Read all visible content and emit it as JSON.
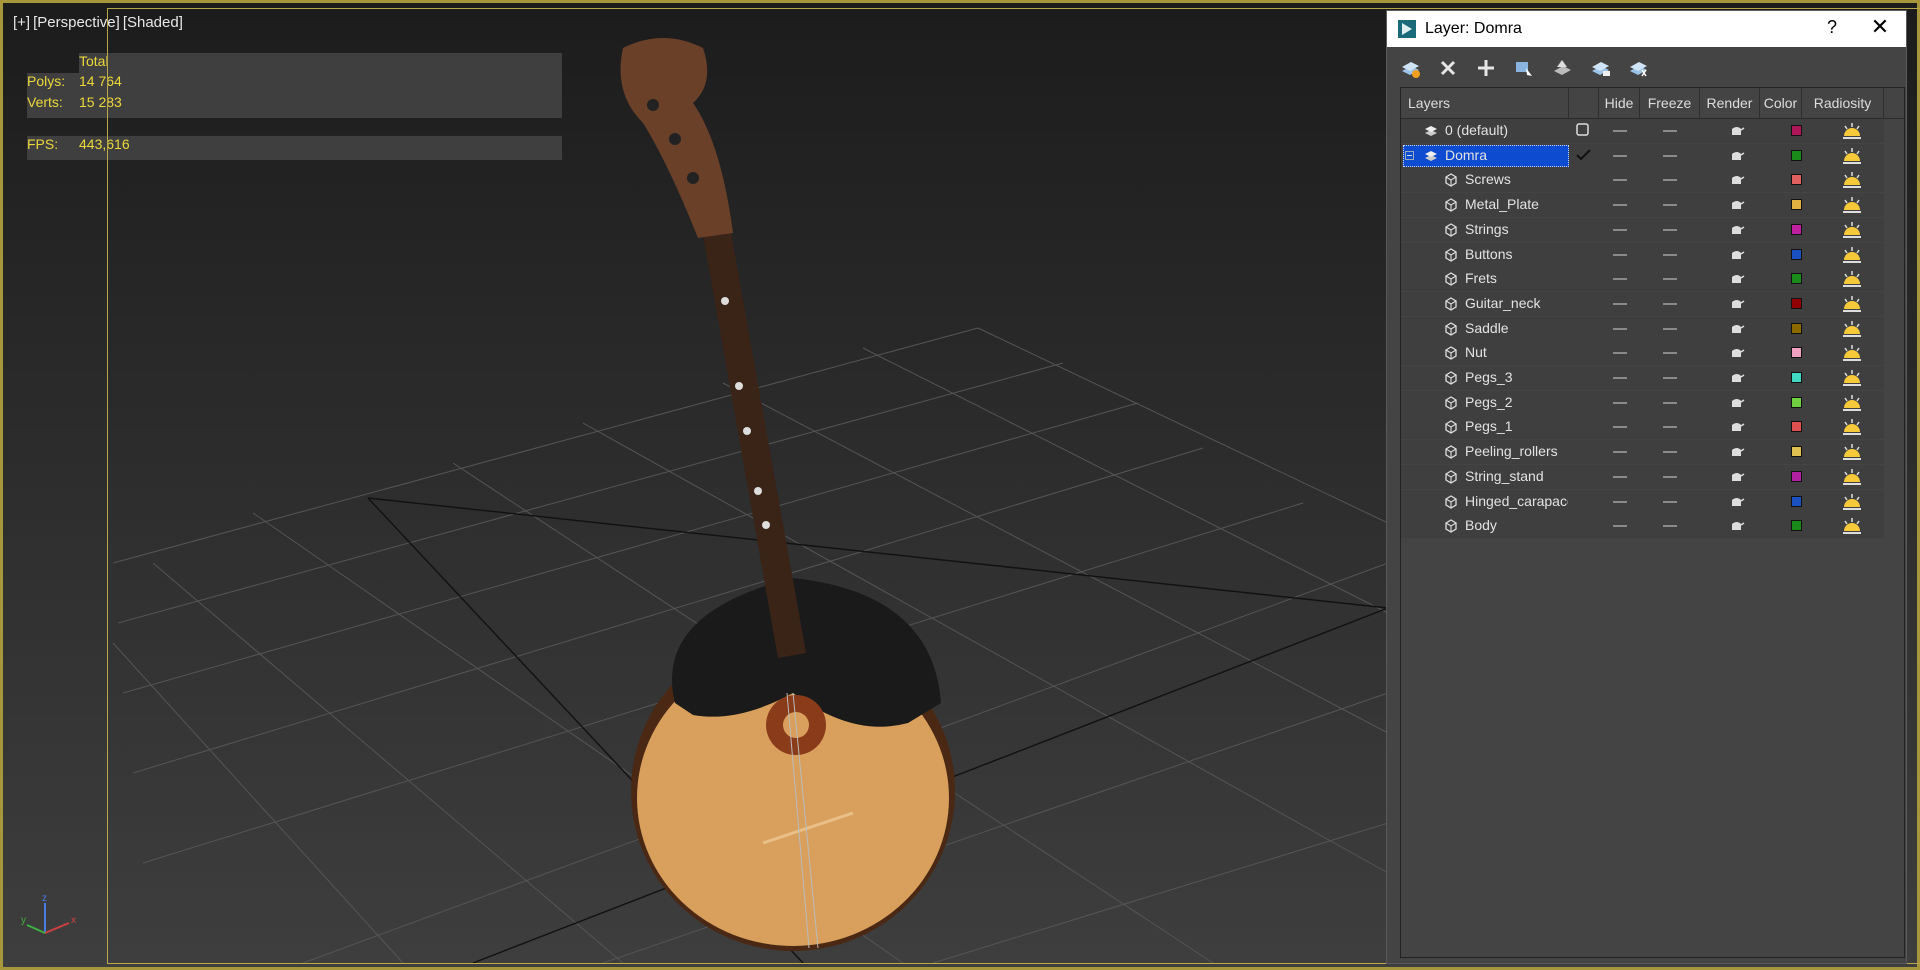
{
  "viewport": {
    "label": [
      "[+]",
      "[Perspective]",
      "[Shaded]"
    ],
    "stats": {
      "total_label": "Total",
      "polys_label": "Polys:",
      "polys_value": "14 764",
      "verts_label": "Verts:",
      "verts_value": "15 283",
      "fps_label": "FPS:",
      "fps_value": "443,616"
    },
    "gizmo": {
      "x": "x",
      "y": "y",
      "z": "z"
    }
  },
  "panel": {
    "title": "Layer: Domra",
    "help": "?",
    "close": "✕",
    "toolbar": [
      "new-layer-icon",
      "delete-layer-icon",
      "add-selection-icon",
      "select-objects-icon",
      "highlight-layer-icon",
      "hide-all-icon",
      "freeze-all-icon"
    ],
    "columns": {
      "layers": "Layers",
      "hide": "Hide",
      "freeze": "Freeze",
      "render": "Render",
      "color": "Color",
      "radiosity": "Radiosity"
    },
    "rows": [
      {
        "name": "0 (default)",
        "kind": "layer",
        "color": "#b0175a"
      },
      {
        "name": "Domra",
        "kind": "layer",
        "color": "#1a8a1a",
        "selected": true,
        "current": true
      },
      {
        "name": "Screws",
        "kind": "object",
        "color": "#e06060"
      },
      {
        "name": "Metal_Plate",
        "kind": "object",
        "color": "#e0b040"
      },
      {
        "name": "Strings",
        "kind": "object",
        "color": "#c020a0"
      },
      {
        "name": "Buttons",
        "kind": "object",
        "color": "#1a50c0"
      },
      {
        "name": "Frets",
        "kind": "object",
        "color": "#1a8a1a"
      },
      {
        "name": "Guitar_neck",
        "kind": "object",
        "color": "#900000"
      },
      {
        "name": "Saddle",
        "kind": "object",
        "color": "#8a6a00"
      },
      {
        "name": "Nut",
        "kind": "object",
        "color": "#f0a0c0"
      },
      {
        "name": "Pegs_3",
        "kind": "object",
        "color": "#40d8c0"
      },
      {
        "name": "Pegs_2",
        "kind": "object",
        "color": "#70d040"
      },
      {
        "name": "Pegs_1",
        "kind": "object",
        "color": "#e05050"
      },
      {
        "name": "Peeling_rollers",
        "kind": "object",
        "color": "#e0c050"
      },
      {
        "name": "String_stand",
        "kind": "object",
        "color": "#b020a0"
      },
      {
        "name": "Hinged_carapace",
        "kind": "object",
        "color": "#1a50c0"
      },
      {
        "name": "Body",
        "kind": "object",
        "color": "#1a8a1a"
      }
    ]
  }
}
